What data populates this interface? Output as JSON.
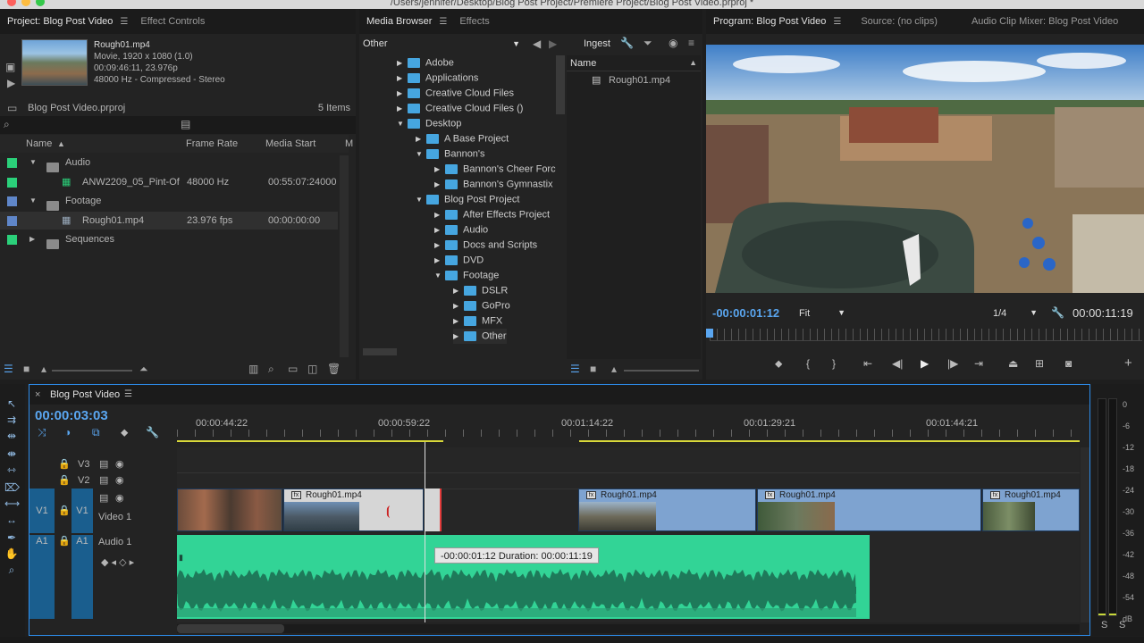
{
  "window": {
    "title": "/Users/jennifer/Desktop/Blog Post Project/Premiere Project/Blog Post Video.prproj *"
  },
  "project": {
    "tabs": [
      "Project: Blog Post Video",
      "Effect Controls"
    ],
    "preview": {
      "name": "Rough01.mp4",
      "line1": "Movie, 1920 x 1080 (1.0)",
      "line2": "00:09:46:11, 23.976p",
      "line3": "48000 Hz - Compressed - Stereo"
    },
    "file": "Blog Post Video.prproj",
    "items": "5 Items",
    "columns": [
      "Name",
      "Frame Rate",
      "Media Start",
      "M"
    ],
    "rows": [
      {
        "name": "Audio",
        "rate": "",
        "start": "",
        "color": "#2bd07a",
        "type": "bin"
      },
      {
        "name": "ANW2209_05_Pint-Of",
        "rate": "48000 Hz",
        "start": "00:55:07:24000",
        "color": "#2bd07a",
        "type": "audio"
      },
      {
        "name": "Footage",
        "rate": "",
        "start": "",
        "color": "#5f86c9",
        "type": "bin"
      },
      {
        "name": "Rough01.mp4",
        "rate": "23.976 fps",
        "start": "00:00:00:00",
        "color": "#5f86c9",
        "type": "video"
      },
      {
        "name": "Sequences",
        "rate": "",
        "start": "",
        "color": "#2bd07a",
        "type": "bin"
      }
    ]
  },
  "media": {
    "tabs": [
      "Media Browser",
      "Effects"
    ],
    "dropdown": "Other",
    "ingest": "Ingest",
    "col": "Name",
    "file": "Rough01.mp4",
    "tree": [
      {
        "label": "Adobe",
        "d": 0,
        "open": false
      },
      {
        "label": "Applications",
        "d": 0,
        "open": false
      },
      {
        "label": "Creative Cloud Files",
        "d": 0,
        "open": false
      },
      {
        "label": "Creative Cloud Files ()",
        "d": 0,
        "open": false
      },
      {
        "label": "Desktop",
        "d": 0,
        "open": true
      },
      {
        "label": "A Base Project",
        "d": 1,
        "open": false
      },
      {
        "label": "Bannon's",
        "d": 1,
        "open": true
      },
      {
        "label": "Bannon's Cheer Forc",
        "d": 2,
        "open": false
      },
      {
        "label": "Bannon's Gymnastix",
        "d": 2,
        "open": false
      },
      {
        "label": "Blog Post Project",
        "d": 1,
        "open": true
      },
      {
        "label": "After Effects Project",
        "d": 2,
        "open": false
      },
      {
        "label": "Audio",
        "d": 2,
        "open": false
      },
      {
        "label": "Docs and Scripts",
        "d": 2,
        "open": false
      },
      {
        "label": "DVD",
        "d": 2,
        "open": false
      },
      {
        "label": "Footage",
        "d": 2,
        "open": true
      },
      {
        "label": "DSLR",
        "d": 3,
        "open": false
      },
      {
        "label": "GoPro",
        "d": 3,
        "open": false
      },
      {
        "label": "MFX",
        "d": 3,
        "open": false
      },
      {
        "label": "Other",
        "d": 3,
        "open": false
      }
    ]
  },
  "program": {
    "tabs": [
      "Program: Blog Post Video",
      "Source: (no clips)",
      "Audio Clip Mixer: Blog Post Video"
    ],
    "timecode": "-00:00:01:12",
    "fit": "Fit",
    "quality": "1/4",
    "duration": "00:00:11:19"
  },
  "timeline": {
    "tab": "Blog Post Video",
    "timecode": "00:00:03:03",
    "ruler": [
      "00:00:44:22",
      "00:00:59:22",
      "00:01:14:22",
      "00:01:29:21",
      "00:01:44:21"
    ],
    "tracks": {
      "v3": "V3",
      "v2": "V2",
      "v1": "V1",
      "a1": "A1",
      "video1": "Video 1",
      "audio1": "Audio 1"
    },
    "clips": [
      "Rough01.mp4",
      "Rough01.mp4",
      "Rough01.mp4",
      "Rough01.mp4"
    ],
    "tooltip": "-00:00:01:12 Duration: 00:00:11:19"
  },
  "meter": {
    "labels": [
      "0",
      "-6",
      "-12",
      "-18",
      "-24",
      "-30",
      "-36",
      "-42",
      "-48",
      "-54",
      "dB"
    ],
    "solo": [
      "S",
      "S"
    ]
  },
  "colors": {
    "accent": "#2d8ceb",
    "timecode": "#5aa6f0",
    "audio": "#32d496",
    "video": "#7ea3d0",
    "playhead": "#e8e8e8"
  }
}
